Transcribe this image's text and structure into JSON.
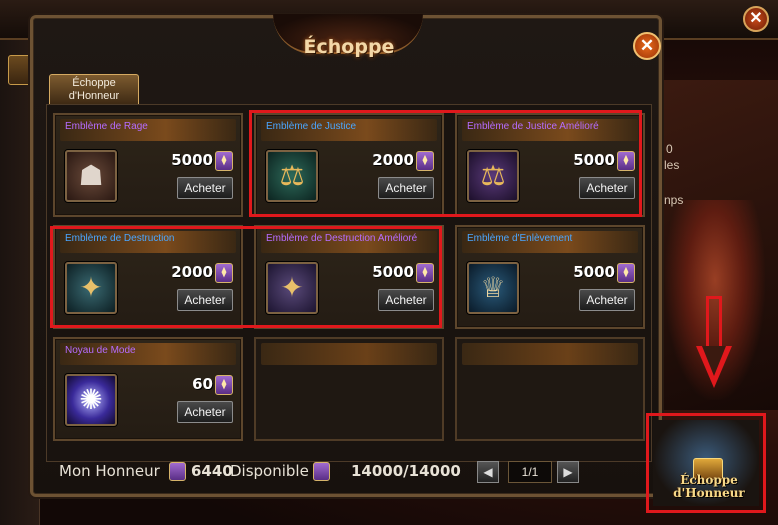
{
  "window": {
    "title": "Échoppe",
    "close_label": "✕"
  },
  "tab": {
    "label_line1": "Échoppe",
    "label_line2": "d'Honneur"
  },
  "items": [
    {
      "name": "Emblème de Rage",
      "price": "5000",
      "button": "Acheter",
      "name_color": "#b56cff"
    },
    {
      "name": "Emblème de Justice",
      "price": "2000",
      "button": "Acheter",
      "name_color": "#4aa6ff"
    },
    {
      "name": "Emblème de Justice Amélioré",
      "price": "5000",
      "button": "Acheter",
      "name_color": "#b56cff"
    },
    {
      "name": "Emblème de Destruction",
      "price": "2000",
      "button": "Acheter",
      "name_color": "#4aa6ff"
    },
    {
      "name": "Emblème de Destruction Amélioré",
      "price": "5000",
      "button": "Acheter",
      "name_color": "#b56cff"
    },
    {
      "name": "Emblème d'Enlèvement",
      "price": "5000",
      "button": "Acheter",
      "name_color": "#4aa6ff"
    },
    {
      "name": "Noyau de Mode",
      "price": "60",
      "button": "Acheter",
      "name_color": "#b56cff"
    }
  ],
  "footer": {
    "honor_label": "Mon Honneur",
    "honor_value": "6440",
    "available_label": "Disponible",
    "available_value": "14000/14000",
    "page": "1/1",
    "prev": "◀",
    "next": "▶"
  },
  "shop_button": {
    "line1": "Échoppe",
    "line2": "d'Honneur"
  },
  "background": {
    "text1": "0",
    "text2": "les",
    "text3": "nps"
  }
}
